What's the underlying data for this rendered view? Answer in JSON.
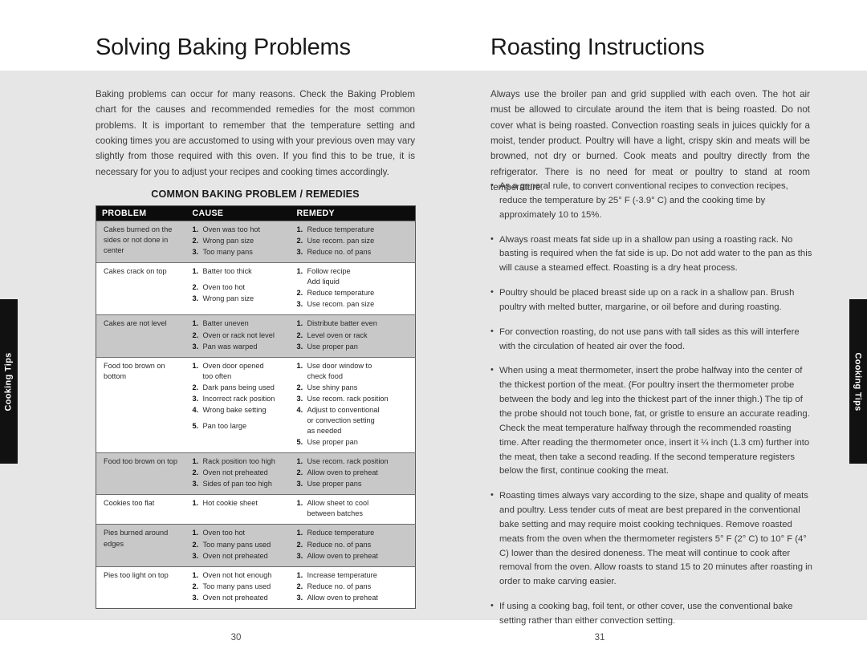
{
  "tabs": {
    "left_label": "Cooking Tips",
    "right_label": "Cooking Tips"
  },
  "left_page": {
    "title": "Solving Baking Problems",
    "intro": "Baking problems can occur for many reasons. Check the Baking Problem chart for the causes and recommended remedies for the most common problems. It is important to remember that the temperature setting and cooking times you are accustomed to using with your previous oven may vary slightly from those required with this oven. If you find this to be true, it is necessary for you to adjust your recipes and cooking times accordingly.",
    "table_heading": "COMMON BAKING PROBLEM / REMEDIES",
    "folio": "30",
    "table": {
      "headers": [
        "PROBLEM",
        "CAUSE",
        "REMEDY"
      ],
      "rows": [
        {
          "problem": "Cakes burned on the sides or not done in center",
          "causes": [
            {
              "n": "1.",
              "text": "Oven was too hot"
            },
            {
              "n": "2.",
              "text": "Wrong pan size"
            },
            {
              "n": "3.",
              "text": "Too many pans"
            }
          ],
          "remedies": [
            {
              "n": "1.",
              "text": "Reduce temperature"
            },
            {
              "n": "2.",
              "text": "Use recom. pan size"
            },
            {
              "n": "3.",
              "text": "Reduce no. of pans"
            }
          ]
        },
        {
          "problem": "Cakes crack on top",
          "causes": [
            {
              "n": "1.",
              "text": "Batter too thick"
            },
            {
              "n": "2.",
              "text": "Oven too hot",
              "gap": true
            },
            {
              "n": "3.",
              "text": "Wrong pan size"
            }
          ],
          "remedies": [
            {
              "n": "1.",
              "text": "Follow recipe",
              "sub": "Add liquid"
            },
            {
              "n": "2.",
              "text": "Reduce temperature"
            },
            {
              "n": "3.",
              "text": "Use recom. pan size"
            }
          ]
        },
        {
          "problem": "Cakes are not level",
          "causes": [
            {
              "n": "1.",
              "text": "Batter uneven"
            },
            {
              "n": "2.",
              "text": "Oven or rack not level"
            },
            {
              "n": "3.",
              "text": "Pan was warped"
            }
          ],
          "remedies": [
            {
              "n": "1.",
              "text": "Distribute batter even"
            },
            {
              "n": "2.",
              "text": "Level oven or rack"
            },
            {
              "n": "3.",
              "text": "Use proper pan"
            }
          ]
        },
        {
          "problem": "Food too brown on bottom",
          "causes": [
            {
              "n": "1.",
              "text": "Oven door opened",
              "sub": "too often"
            },
            {
              "n": "2.",
              "text": "Dark pans being used"
            },
            {
              "n": "3.",
              "text": "Incorrect rack position"
            },
            {
              "n": "4.",
              "text": "Wrong bake setting"
            },
            {
              "n": "5.",
              "text": "Pan too large",
              "gap": true
            }
          ],
          "remedies": [
            {
              "n": "1.",
              "text": "Use door window to",
              "sub": "check food"
            },
            {
              "n": "2.",
              "text": "Use shiny pans"
            },
            {
              "n": "3.",
              "text": "Use recom. rack position"
            },
            {
              "n": "4.",
              "text": "Adjust to conventional",
              "sub": "or convection setting",
              "sub2": "as needed"
            },
            {
              "n": "5.",
              "text": "Use proper pan"
            }
          ]
        },
        {
          "problem": "Food too brown on top",
          "causes": [
            {
              "n": "1.",
              "text": "Rack position too high"
            },
            {
              "n": "2.",
              "text": "Oven not preheated"
            },
            {
              "n": "3.",
              "text": "Sides of pan too high"
            }
          ],
          "remedies": [
            {
              "n": "1.",
              "text": "Use recom. rack position"
            },
            {
              "n": "2.",
              "text": "Allow oven to preheat"
            },
            {
              "n": "3.",
              "text": "Use proper pans"
            }
          ]
        },
        {
          "problem": "Cookies too flat",
          "causes": [
            {
              "n": "1.",
              "text": "Hot cookie sheet"
            }
          ],
          "remedies": [
            {
              "n": "1.",
              "text": "Allow sheet to cool",
              "sub": "between batches"
            }
          ]
        },
        {
          "problem": "Pies burned around edges",
          "causes": [
            {
              "n": "1.",
              "text": "Oven too hot"
            },
            {
              "n": "2.",
              "text": "Too many pans used"
            },
            {
              "n": "3.",
              "text": "Oven not preheated"
            }
          ],
          "remedies": [
            {
              "n": "1.",
              "text": "Reduce temperature"
            },
            {
              "n": "2.",
              "text": "Reduce no. of pans"
            },
            {
              "n": "3.",
              "text": "Allow oven to preheat"
            }
          ]
        },
        {
          "problem": "Pies too light on top",
          "causes": [
            {
              "n": "1.",
              "text": "Oven not hot enough"
            },
            {
              "n": "2.",
              "text": "Too many pans used"
            },
            {
              "n": "3.",
              "text": "Oven not preheated"
            }
          ],
          "remedies": [
            {
              "n": "1.",
              "text": "Increase temperature"
            },
            {
              "n": "2.",
              "text": "Reduce no. of pans"
            },
            {
              "n": "3.",
              "text": "Allow oven to preheat"
            }
          ]
        }
      ]
    }
  },
  "right_page": {
    "title": "Roasting Instructions",
    "intro": "Always use the broiler pan and grid supplied with each oven. The hot air must be allowed to circulate around the item that is being roasted. Do not cover what is being roasted. Convection roasting seals in juices quickly for a moist, tender product. Poultry will have a light, crispy skin and meats will be browned, not dry or burned. Cook meats and poultry directly from the refrigerator. There is no need for meat or poultry to stand at room temperature.",
    "folio": "31",
    "bullets": [
      "As a general rule, to convert conventional recipes to convection recipes, reduce the temperature by 25° F (-3.9° C) and the cooking time by approximately 10 to 15%.",
      "Always roast meats fat side up in a shallow pan using a roasting rack.  No basting is required when the fat side is up.  Do not add water to the pan as this will cause a steamed effect. Roasting is a dry heat process.",
      "Poultry should be placed breast side up on a rack in a shallow pan.  Brush poultry with melted butter, margarine, or oil before and during roasting.",
      "For convection roasting, do not use pans with tall sides as this will interfere with the circulation of heated air over the food.",
      "When using a meat thermometer, insert the probe halfway into the center of the thickest portion of the meat.  (For poultry insert the thermometer probe between the body and leg into the thickest part of the inner thigh.)  The tip of the probe should not touch bone, fat, or gristle to ensure an accurate reading. Check the meat temperature halfway through the recommended roasting time.  After reading the thermometer once, insert it ¼ inch (1.3 cm) further into the meat, then take a second reading.  If the second temperature registers below the first, continue cooking the meat.",
      "Roasting times always vary according to the size, shape and quality of meats and poultry.  Less tender cuts of meat are best prepared in the conventional bake setting and may require moist cooking techniques.  Remove roasted meats from the oven when the thermometer registers 5° F (2° C) to 10° F (4° C) lower than the desired doneness. The meat will continue to cook after removal from the oven.  Allow roasts to stand 15 to 20 minutes after roasting in order to make carving easier.",
      "If using a cooking bag, foil tent, or other cover, use the conventional bake setting rather than either convection setting."
    ]
  },
  "colors": {
    "page_background": "#ffffff",
    "content_band": "#e6e6e6",
    "table_header_bg": "#0c0c0c",
    "table_header_text": "#ffffff",
    "table_row_shade": "#c8c8c8",
    "table_row_plain": "#ffffff",
    "tab_background": "#111111",
    "body_text": "#3a3a3a"
  }
}
